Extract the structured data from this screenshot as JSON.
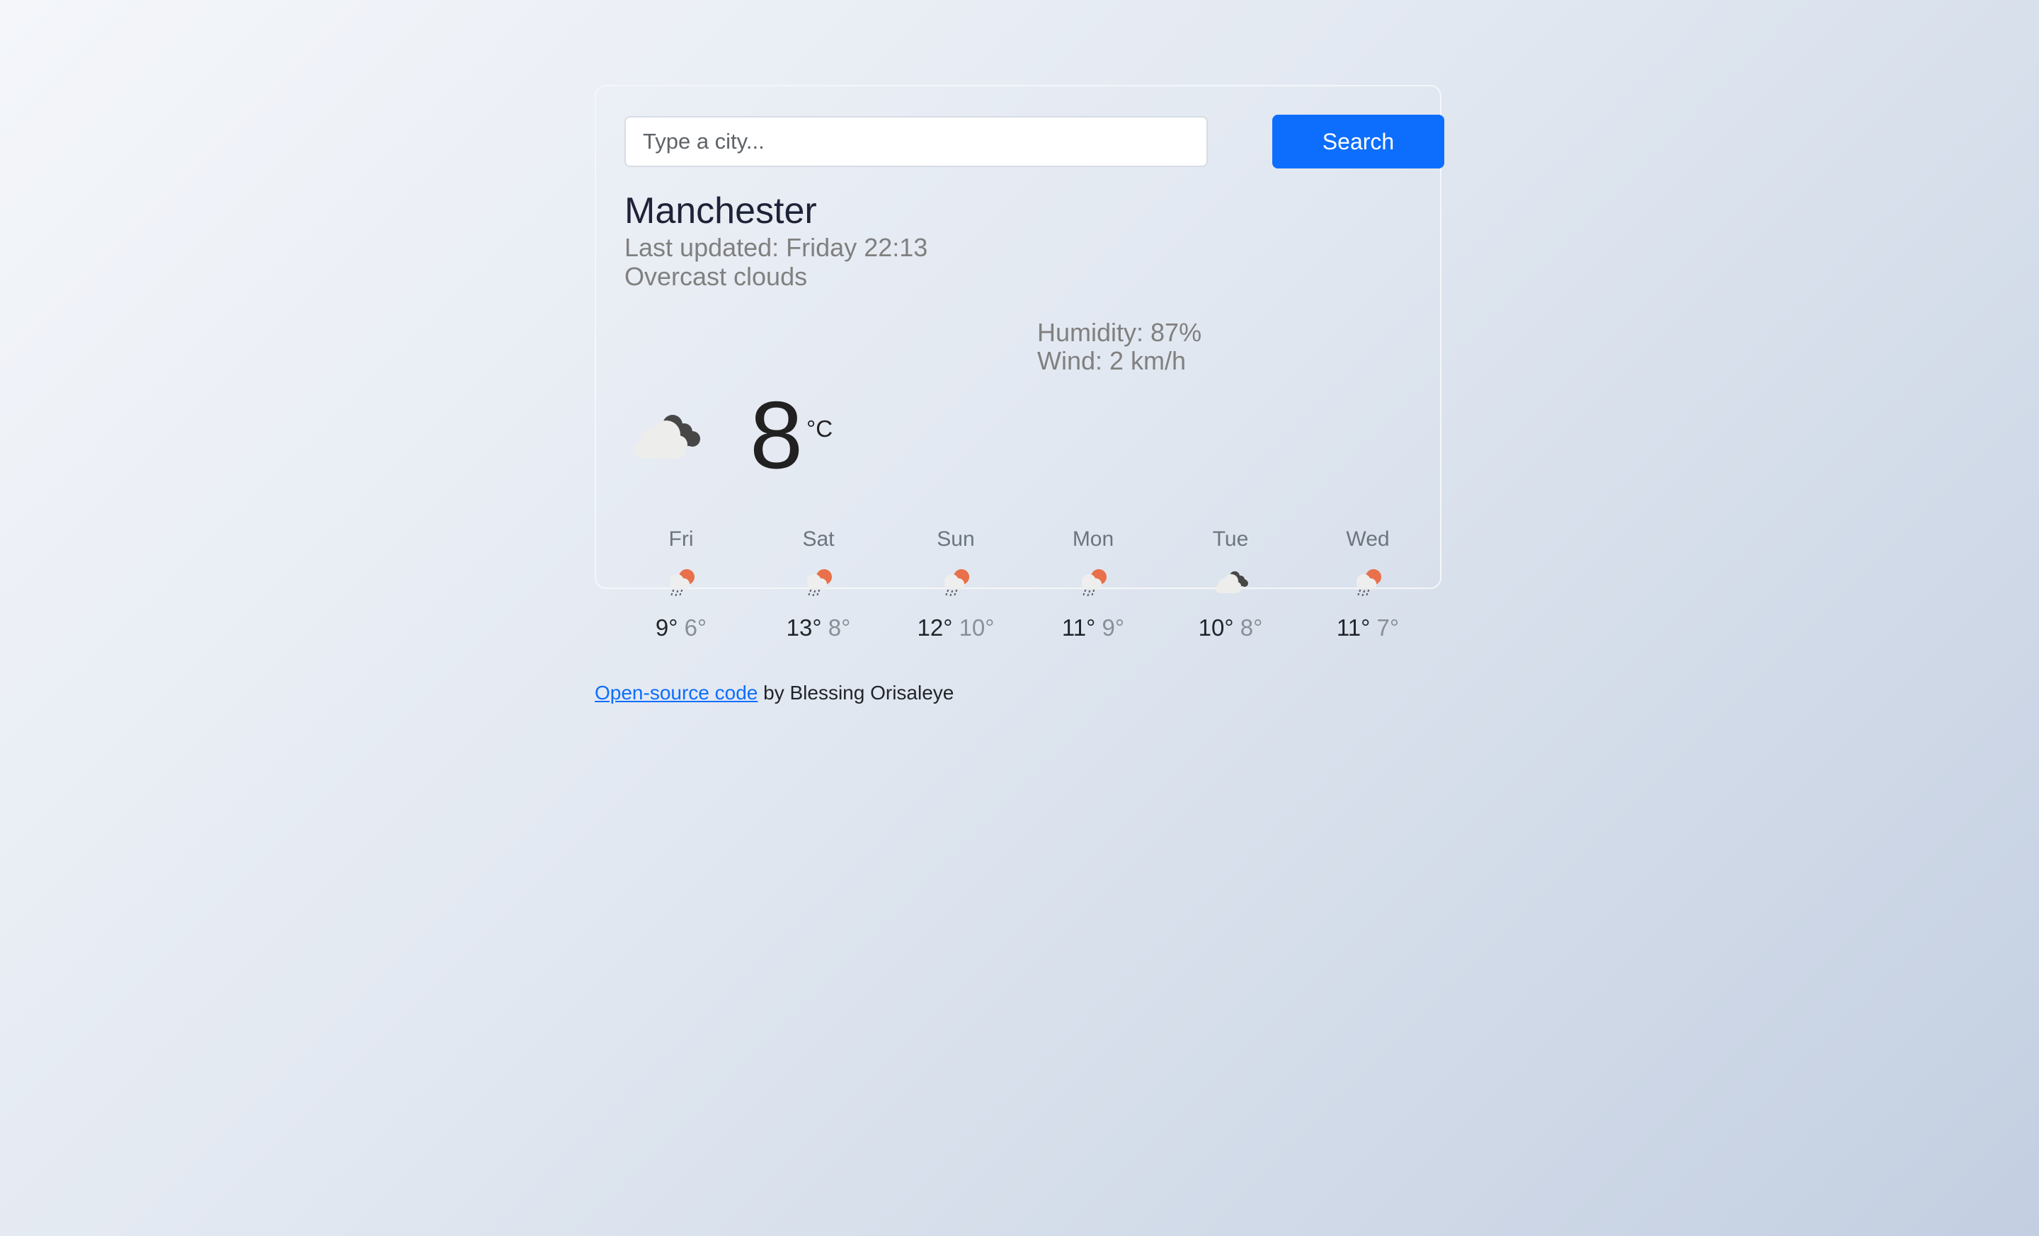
{
  "search": {
    "placeholder": "Type a city...",
    "value": "",
    "button_label": "Search"
  },
  "current": {
    "city": "Manchester",
    "last_updated": "Last updated: Friday 22:13",
    "description": "Overcast clouds",
    "temperature": "8",
    "unit": "°C",
    "icon": "overcast-clouds-icon",
    "humidity": "Humidity: 87%",
    "wind": "Wind: 2 km/h"
  },
  "forecast": [
    {
      "day": "Fri",
      "max": "9°",
      "min": "6°",
      "icon": "sun-rain-icon"
    },
    {
      "day": "Sat",
      "max": "13°",
      "min": "8°",
      "icon": "sun-rain-icon"
    },
    {
      "day": "Sun",
      "max": "12°",
      "min": "10°",
      "icon": "sun-rain-icon"
    },
    {
      "day": "Mon",
      "max": "11°",
      "min": "9°",
      "icon": "sun-rain-icon"
    },
    {
      "day": "Tue",
      "max": "10°",
      "min": "8°",
      "icon": "overcast-clouds-icon"
    },
    {
      "day": "Wed",
      "max": "11°",
      "min": "7°",
      "icon": "sun-rain-icon"
    }
  ],
  "footer": {
    "link_text": "Open-source code",
    "text": " by Blessing Orisaleye"
  },
  "colors": {
    "accent": "#0d6efd",
    "sun": "#e8704a",
    "dark_cloud": "#474747",
    "light_cloud": "#eeeeee"
  }
}
